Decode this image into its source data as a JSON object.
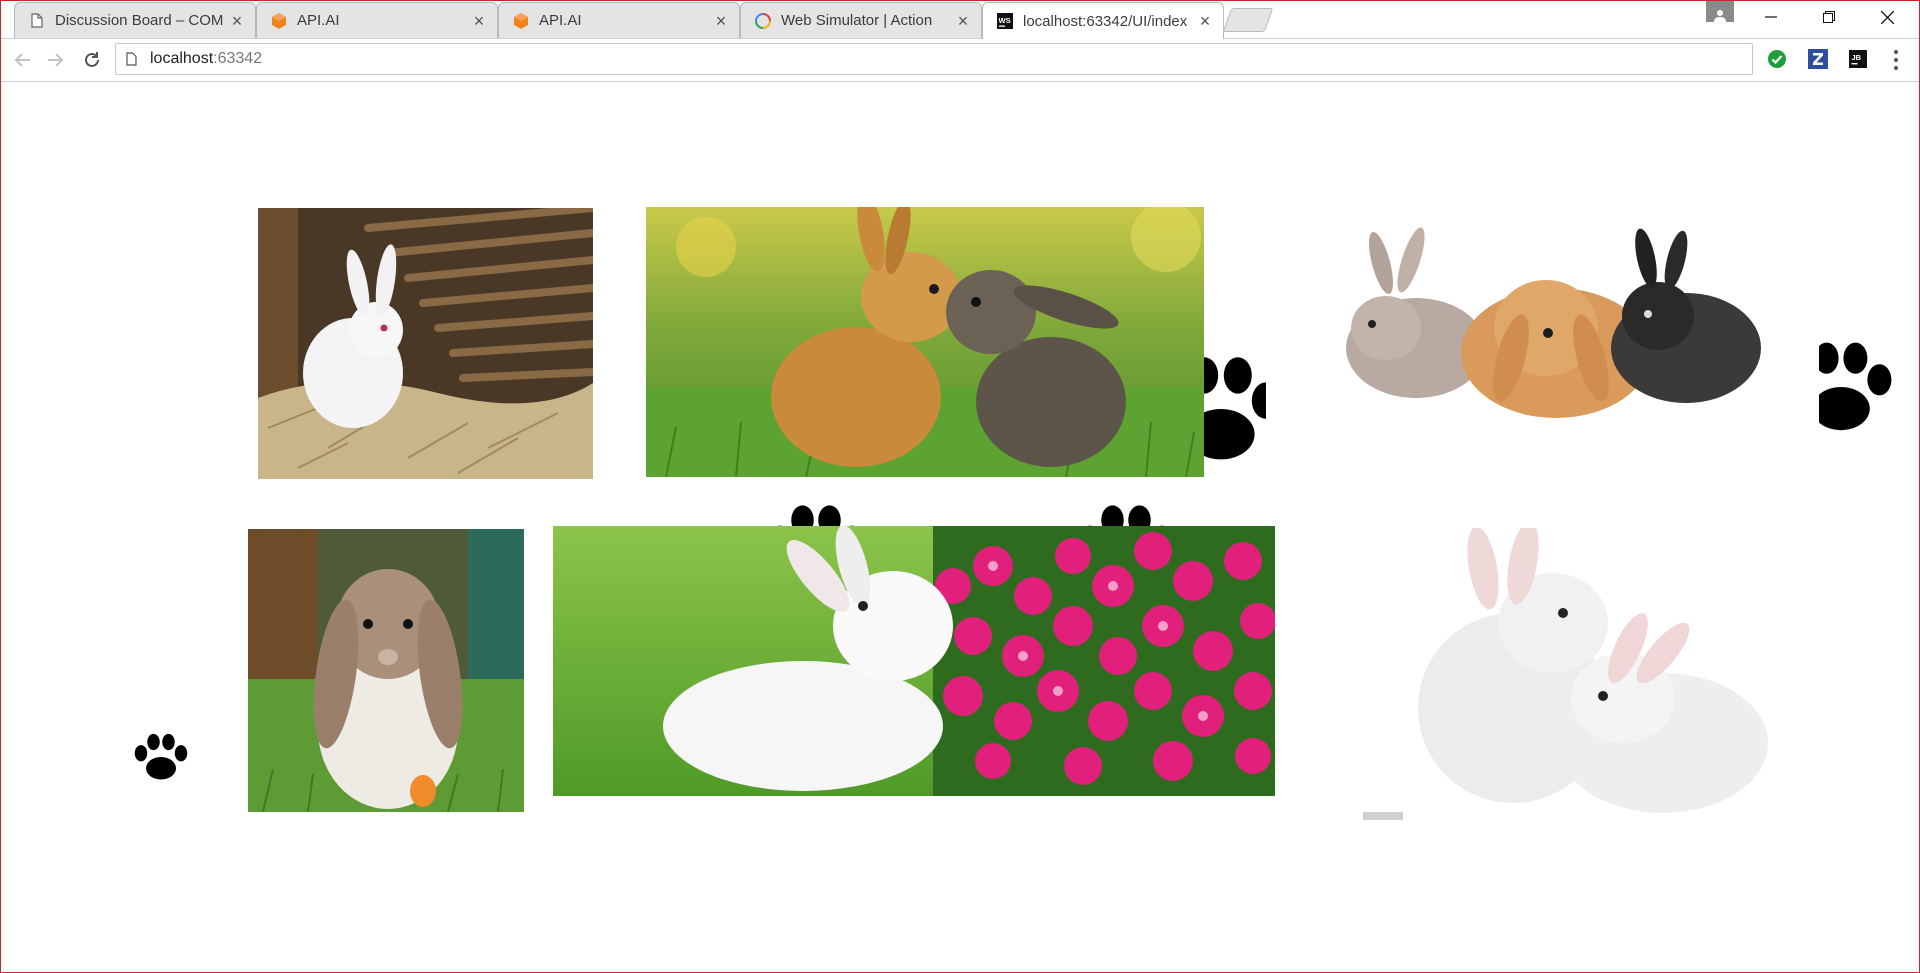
{
  "tabs": [
    {
      "title": "Discussion Board – COM",
      "icon": "page-icon",
      "active": false
    },
    {
      "title": "API.AI",
      "icon": "api-ai-icon",
      "active": false
    },
    {
      "title": "API.AI",
      "icon": "api-ai-icon",
      "active": false
    },
    {
      "title": "Web Simulator  |  Action",
      "icon": "actions-google-icon",
      "active": false
    },
    {
      "title": "localhost:63342/UI/index",
      "icon": "webstorm-icon",
      "active": true
    }
  ],
  "address_bar": {
    "host": "localhost",
    "rest": ":63342"
  },
  "extensions": [
    "checkmark-extension-icon",
    "zotero-extension-icon",
    "jetbrains-extension-icon"
  ],
  "colors": {
    "window_border": "#c8262b",
    "api_ai_orange": "#f0831e",
    "check_green": "#1e9e3a",
    "zotero_blue": "#2c4f9e"
  },
  "gallery": {
    "images": [
      "white-rabbit-in-straw-hutch",
      "two-bunnies-kissing-on-grass",
      "three-rabbits-on-white",
      "lop-eared-rabbit-with-egg",
      "white-rabbit-beside-pink-flowers",
      "two-white-rabbits-on-white"
    ],
    "decorations": [
      "paw-print-icon",
      "paw-print-icon",
      "paw-print-icon"
    ]
  }
}
